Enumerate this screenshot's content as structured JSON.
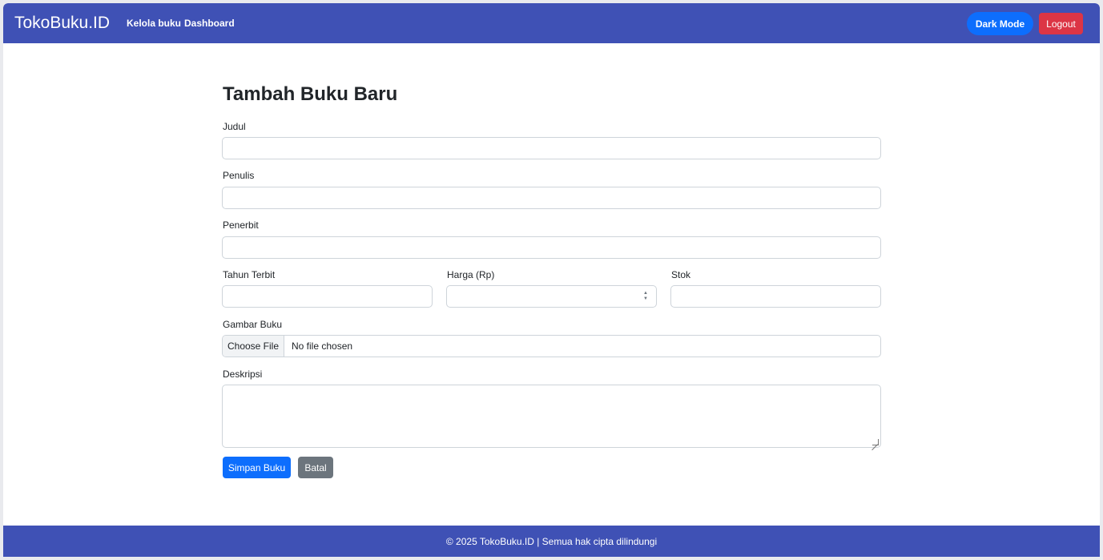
{
  "navbar": {
    "brand": "TokoBuku.ID",
    "links": [
      "Kelola buku",
      "Dashboard"
    ],
    "dark_mode_label": "Dark Mode",
    "logout_label": "Logout",
    "bg_color": "#3f51b5"
  },
  "form": {
    "title": "Tambah Buku Baru",
    "judul": {
      "label": "Judul",
      "value": ""
    },
    "penulis": {
      "label": "Penulis",
      "value": ""
    },
    "penerbit": {
      "label": "Penerbit",
      "value": ""
    },
    "tahun_terbit": {
      "label": "Tahun Terbit",
      "value": ""
    },
    "harga": {
      "label": "Harga (Rp)",
      "value": ""
    },
    "stok": {
      "label": "Stok",
      "value": ""
    },
    "gambar": {
      "label": "Gambar Buku",
      "button": "Choose File",
      "status": "No file chosen"
    },
    "deskripsi": {
      "label": "Deskripsi",
      "value": ""
    },
    "save_label": "Simpan Buku",
    "cancel_label": "Batal"
  },
  "footer": {
    "text": "© 2025 TokoBuku.ID | Semua hak cipta dilindungi"
  },
  "colors": {
    "primary": "#0d6efd",
    "danger": "#dc3545",
    "secondary": "#6c757d"
  }
}
